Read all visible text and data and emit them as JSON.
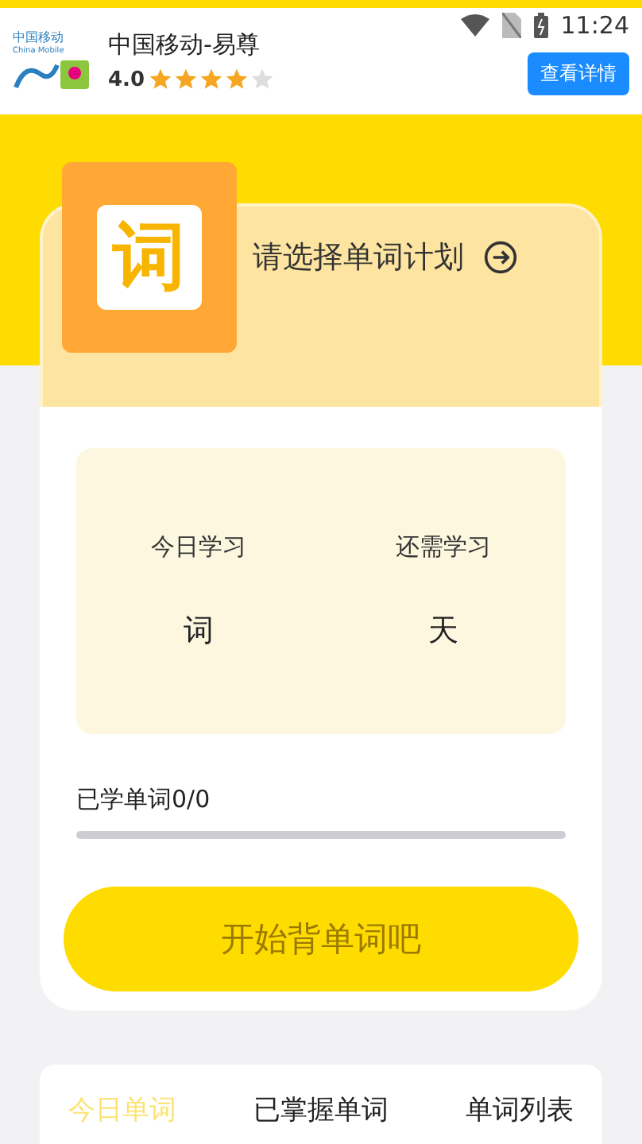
{
  "status_bar": {
    "time": "11:24"
  },
  "ad": {
    "brand_line": "中国移动",
    "brand_sub": "China Mobile",
    "title": "中国移动-易尊",
    "rating": "4.0",
    "stars": 4,
    "button": "查看详情"
  },
  "plan": {
    "icon_text": "词",
    "title": "请选择单词计划"
  },
  "stats": [
    {
      "label": "今日学习",
      "value": "词"
    },
    {
      "label": "还需学习",
      "value": "天"
    }
  ],
  "progress": {
    "label": "已学单词0/0",
    "level": 0
  },
  "start_button": "开始背单词吧",
  "tabs": [
    {
      "label": "今日单词",
      "selected": true
    },
    {
      "label": "已掌握单词",
      "selected": false
    },
    {
      "label": "单词列表",
      "selected": false
    }
  ]
}
